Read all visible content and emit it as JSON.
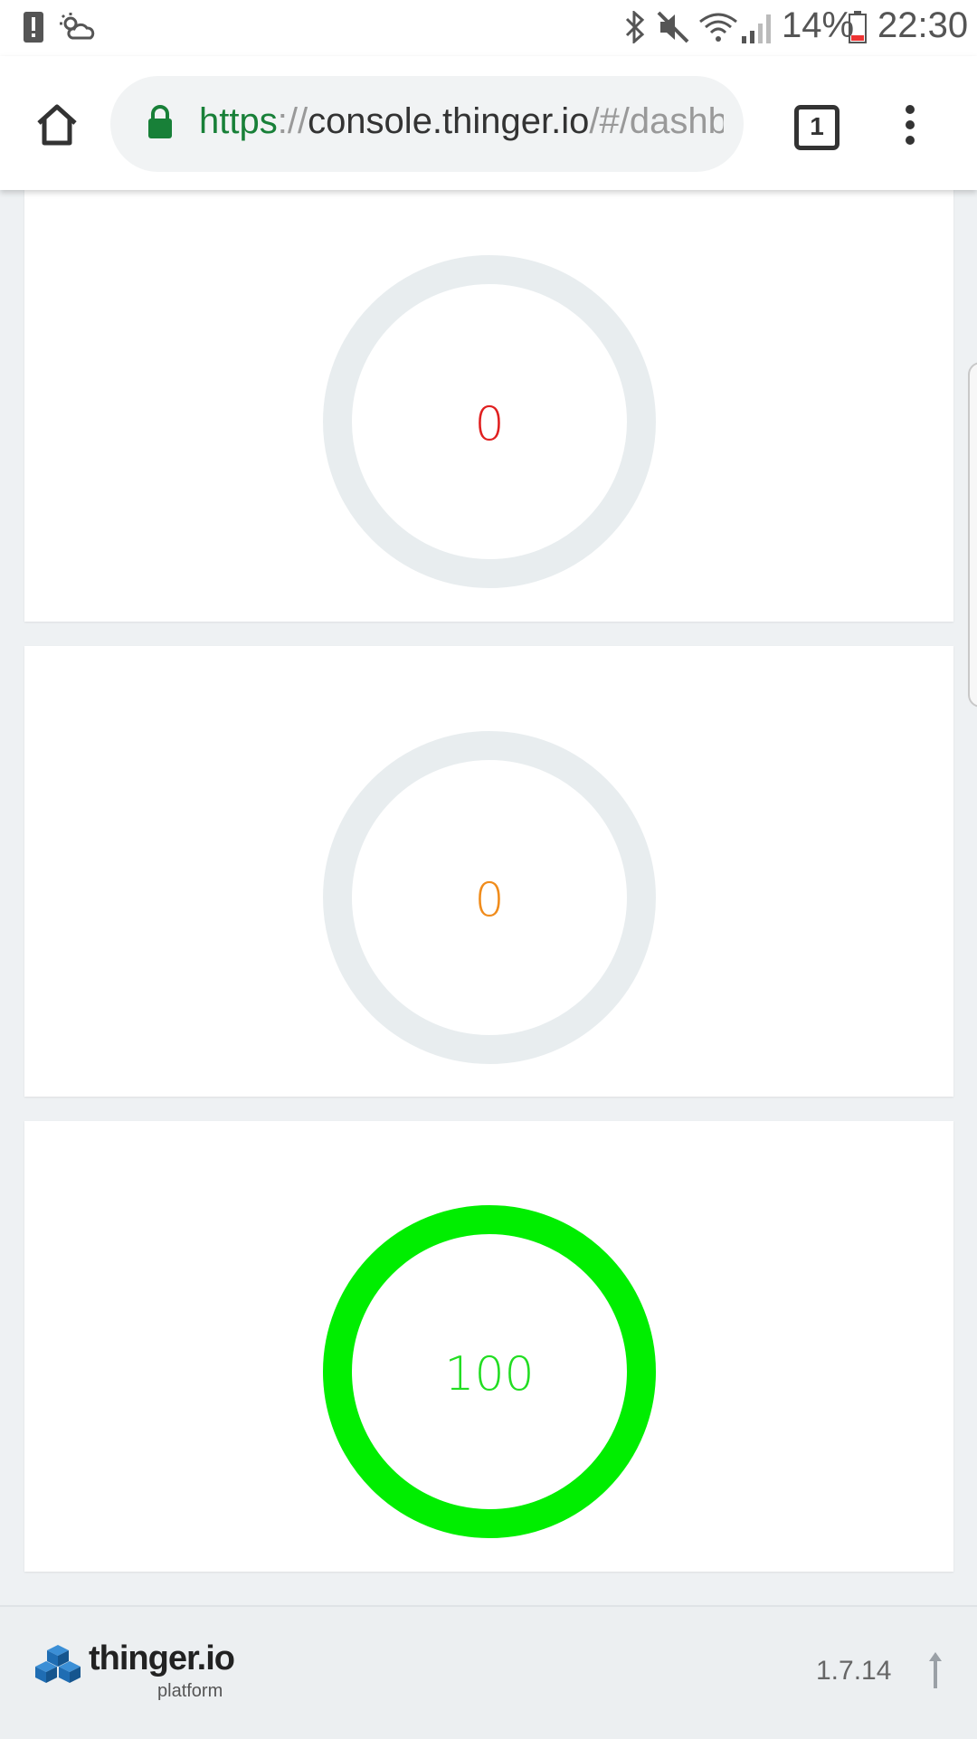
{
  "status_bar": {
    "battery_percent": "14%",
    "time": "22:30",
    "icons": [
      "alert-icon",
      "weather-icon",
      "bluetooth-icon",
      "mute-icon",
      "wifi-icon",
      "signal-icon",
      "battery-icon"
    ]
  },
  "browser": {
    "url_scheme": "https",
    "url_sep": "://",
    "url_host": "console.thinger.io",
    "url_path": "/#/dashb",
    "tab_count": "1",
    "icons": [
      "home-icon",
      "lock-icon",
      "tabs-icon",
      "more-vert-icon"
    ]
  },
  "widgets": [
    {
      "value": "0",
      "color": "#e02020",
      "ring_color": "#e8edef",
      "fill_fraction": 0
    },
    {
      "value": "0",
      "color": "#f08c1c",
      "ring_color": "#e8edef",
      "fill_fraction": 0
    },
    {
      "value": "100",
      "color": "#22dd22",
      "ring_color": "#00ee00",
      "fill_fraction": 1
    }
  ],
  "footer": {
    "brand_name": "thinger.io",
    "brand_sub": "platform",
    "version": "1.7.14",
    "icons": [
      "thinger-logo-icon",
      "scroll-top-icon"
    ]
  }
}
